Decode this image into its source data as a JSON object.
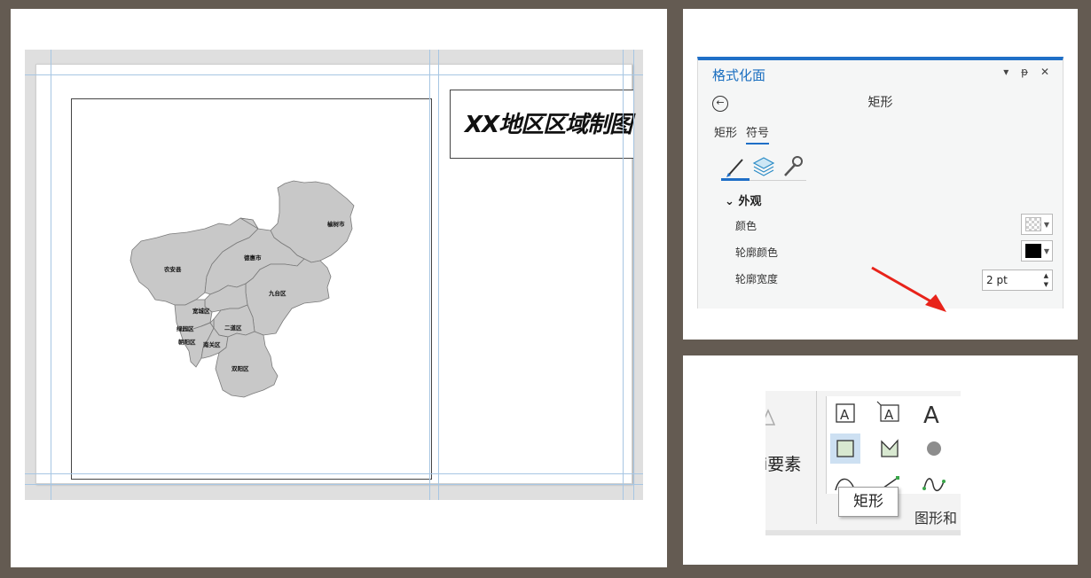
{
  "layout_view": {
    "title": "XX地区区域制图",
    "map_labels": [
      "榆树市",
      "农安县",
      "德惠市",
      "九台区",
      "宽城区",
      "绿园区",
      "二道区",
      "朝阳区",
      "南关区",
      "双阳区"
    ]
  },
  "format_pane": {
    "title": "格式化面",
    "controls": {
      "dropdown": "▾",
      "pin": "ᵽ",
      "close": "✕"
    },
    "back_icon": "←",
    "subtitle": "矩形",
    "tabs": [
      "矩形",
      "符号"
    ],
    "active_tab": "符号",
    "icons": [
      "brush-icon",
      "layers-icon",
      "wrench-icon"
    ],
    "section": {
      "label": "外观",
      "expander": "⌄"
    },
    "properties": {
      "color_label": "颜色",
      "outline_color_label": "轮廓颜色",
      "outline_width_label": "轮廓宽度",
      "outline_width_value": "2 pt",
      "color_value": "transparent",
      "outline_color_value": "#000000"
    },
    "accent_color": "#1f6fc7",
    "annotation_arrow_color": "#e8231a"
  },
  "ribbon": {
    "partial_label": "i要素",
    "group_label": "图形和",
    "tooltip": "矩形",
    "gallery_tools": [
      "text-icon",
      "callout-text-icon",
      "large-text-icon",
      "rectangle-icon",
      "polygon-icon",
      "circle-icon",
      "freehand-icon",
      "line-icon",
      "curve-icon"
    ]
  }
}
